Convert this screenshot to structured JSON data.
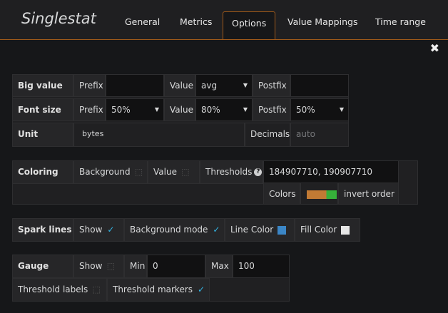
{
  "panel": {
    "title": "Singlestat",
    "close_icon": "close-icon"
  },
  "tabs": [
    {
      "label": "General",
      "active": false
    },
    {
      "label": "Metrics",
      "active": false
    },
    {
      "label": "Options",
      "active": true
    },
    {
      "label": "Value Mappings",
      "active": false
    },
    {
      "label": "Time range",
      "active": false
    }
  ],
  "big_value": {
    "label": "Big value",
    "prefix_label": "Prefix",
    "prefix_value": "",
    "value_label": "Value",
    "value_selected": "avg",
    "postfix_label": "Postfix",
    "postfix_value": ""
  },
  "font_size": {
    "label": "Font size",
    "prefix_label": "Prefix",
    "prefix_selected": "50%",
    "value_label": "Value",
    "value_selected": "80%",
    "postfix_label": "Postfix",
    "postfix_selected": "50%"
  },
  "unit": {
    "label": "Unit",
    "value": "bytes",
    "decimals_label": "Decimals",
    "decimals_placeholder": "auto"
  },
  "coloring": {
    "label": "Coloring",
    "background_label": "Background",
    "background_checked": false,
    "value_label": "Value",
    "value_checked": false,
    "thresholds_label": "Thresholds",
    "thresholds_value": "184907710, 190907710",
    "colors_label": "Colors",
    "colors": [
      "#c17a34",
      "#36b03a"
    ],
    "invert_label": "invert order"
  },
  "spark_lines": {
    "label": "Spark lines",
    "show_label": "Show",
    "show_checked": true,
    "background_mode_label": "Background mode",
    "background_mode_checked": true,
    "line_color_label": "Line Color",
    "line_color": "#3b86c6",
    "fill_color_label": "Fill Color",
    "fill_color": "#e6e6e6"
  },
  "gauge": {
    "label": "Gauge",
    "show_label": "Show",
    "show_checked": false,
    "min_label": "Min",
    "min_value": "0",
    "max_label": "Max",
    "max_value": "100",
    "threshold_labels_label": "Threshold labels",
    "threshold_labels_checked": false,
    "threshold_markers_label": "Threshold markers",
    "threshold_markers_checked": true
  },
  "accent_color": "#a05a1a"
}
